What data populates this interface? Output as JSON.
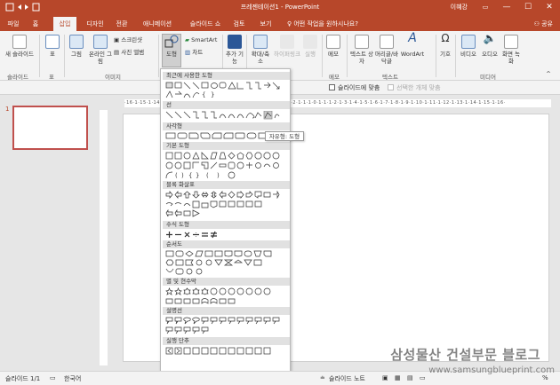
{
  "window": {
    "title": "프레젠테이션1 - PowerPoint",
    "user": "이혜강",
    "minimize": "—",
    "maximize": "☐",
    "close": "✕"
  },
  "tabs": [
    "파일",
    "홈",
    "삽입",
    "디자인",
    "전환",
    "애니메이션",
    "슬라이드 쇼",
    "검토",
    "보기"
  ],
  "active_tab": "삽입",
  "tell_me": "어떤 작업을 원하시나요?",
  "share": "공유",
  "ribbon": {
    "new_slide": "새 슬라이드",
    "slides_group": "슬라이드",
    "table": "표",
    "table_group": "표",
    "picture": "그림",
    "online_picture": "온라인 그림",
    "screenshot": "스크린샷",
    "photo_album": "사진 앨범",
    "images_group": "이미지",
    "shapes": "도형",
    "smartart": "SmartArt",
    "chart": "차트",
    "addins": "추가 기능",
    "zoom": "확대/축소",
    "hyperlink": "하이퍼링크",
    "action": "실행",
    "comment": "메모",
    "comment_group": "메모",
    "textbox": "텍스트 상자",
    "header_footer": "머리글/바닥글",
    "wordart": "WordArt",
    "text_group": "텍스트",
    "symbols": "기호",
    "video": "비디오",
    "audio": "오디오",
    "screen_record": "화면 녹화",
    "media_group": "미디어"
  },
  "fmtbar": {
    "fit_to_slide": "슬라이드에 맞춤",
    "fit_to_selection": "선택한 개체 맞춤"
  },
  "slides": {
    "number": "1"
  },
  "ruler": {
    "horizontal": "·16·1·15·1·14·1·13·1·12·1·11·1·10·1·9·1·8·1·7·1·6·1·5·1·4·1·3·1·2·1·1·1·0·1·1·1·2·1·3·1·4·1·5·1·6·1·7·1·8·1·9·1·10·1·11·1·12·1·13·1·14·1·15·1·16·"
  },
  "dropdown": {
    "recent": "최근에 사용한 도형",
    "lines": "선",
    "rectangles": "사각형",
    "basic": "기본 도형",
    "block_arrows": "블록 화살표",
    "equation": "수식 도형",
    "flowchart": "순서도",
    "stars": "별 및 현수막",
    "callouts": "설명선",
    "action_buttons": "실행 단추"
  },
  "tooltip": "자유형: 도형",
  "status": {
    "slide": "슬라이드 1/1",
    "language": "한국어",
    "notes": "슬라이드 노트",
    "zoom_pct": "%"
  },
  "watermark": {
    "line1": "삼성물산 건설부문 블로그",
    "line2": "www.samsungblueprint.com"
  },
  "colors": {
    "accent": "#b7472a",
    "selected_slide": "#c0504d"
  }
}
